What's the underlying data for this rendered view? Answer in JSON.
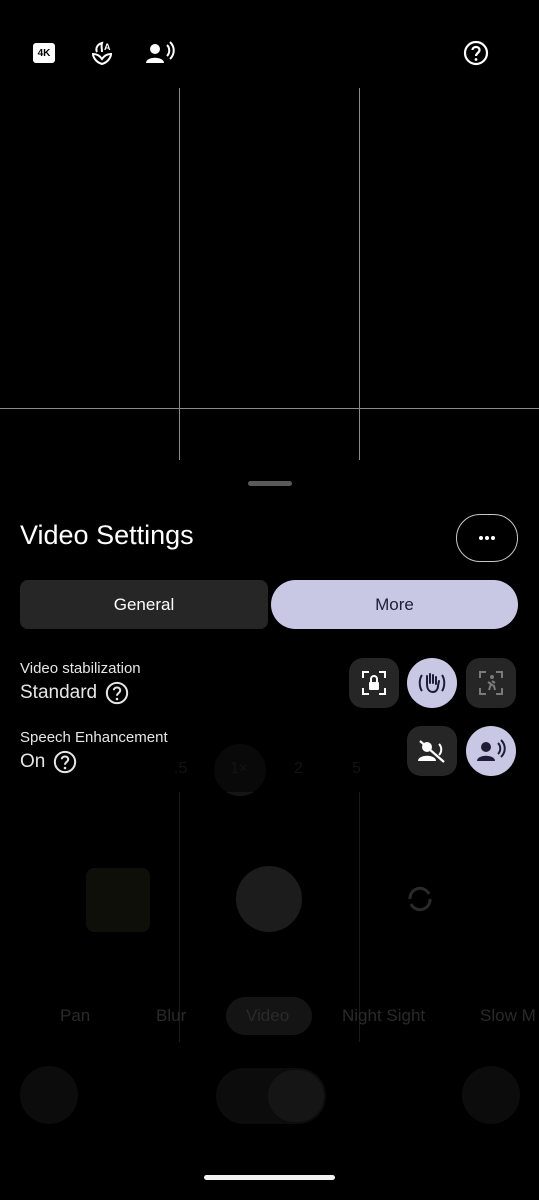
{
  "top_bar": {
    "resolution_badge": "4K",
    "icons": [
      "4k-icon",
      "auto-enhance-icon",
      "speech-icon",
      "help-icon"
    ]
  },
  "background": {
    "zoom_levels": [
      ".5",
      "1×",
      "2",
      "5"
    ],
    "modes": [
      "Pan",
      "Blur",
      "Video",
      "Night Sight",
      "Slow M"
    ]
  },
  "sheet": {
    "title": "Video Settings",
    "tabs": [
      {
        "label": "General",
        "selected": false
      },
      {
        "label": "More",
        "selected": true
      }
    ],
    "settings": [
      {
        "label": "Video stabilization",
        "value": "Standard",
        "options": [
          "lock-stabilization-icon",
          "standard-stabilization-icon",
          "active-stabilization-icon"
        ],
        "selected_option": 1
      },
      {
        "label": "Speech Enhancement",
        "value": "On",
        "options": [
          "speech-off-icon",
          "speech-on-icon"
        ],
        "selected_option": 1
      }
    ]
  },
  "colors": {
    "accent": "#c9c8e4",
    "background": "#000000",
    "chip": "#262626"
  }
}
